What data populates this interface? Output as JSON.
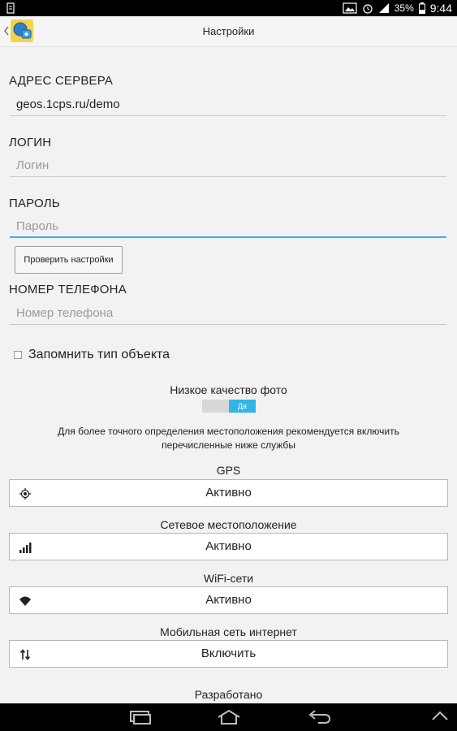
{
  "status_bar": {
    "battery_percent": "35%",
    "time": "9:44"
  },
  "action_bar": {
    "title": "Настройки"
  },
  "server": {
    "label": "АДРЕС СЕРВЕРА",
    "value": "geos.1cps.ru/demo"
  },
  "login": {
    "label": "ЛОГИН",
    "placeholder": "Логин"
  },
  "password": {
    "label": "ПАРОЛЬ",
    "placeholder": "Пароль"
  },
  "check_button": {
    "label": "Проверить настройки"
  },
  "phone": {
    "label": "НОМЕР ТЕЛЕФОНА",
    "placeholder": "Номер телефона"
  },
  "remember": {
    "label": "Запомнить тип объекта",
    "checked": false
  },
  "photo_quality": {
    "label": "Низкое качество фото",
    "toggle_label": "Да",
    "on": true
  },
  "recommendation": {
    "line1": "Для более точного определения местоположения рекомендуется включить",
    "line2": "перечисленные ниже службы"
  },
  "services": [
    {
      "name": "GPS",
      "status": "Активно",
      "icon": "gps-icon"
    },
    {
      "name": "Сетевое местоположение",
      "status": "Активно",
      "icon": "signal-bars-icon"
    },
    {
      "name": "WiFi-сети",
      "status": "Активно",
      "icon": "wifi-icon"
    },
    {
      "name": "Мобильная сеть интернет",
      "status": "Включить",
      "icon": "mobile-data-icon"
    }
  ],
  "footer": {
    "developed_label": "Разработано"
  },
  "colors": {
    "accent": "#33b5e5"
  }
}
